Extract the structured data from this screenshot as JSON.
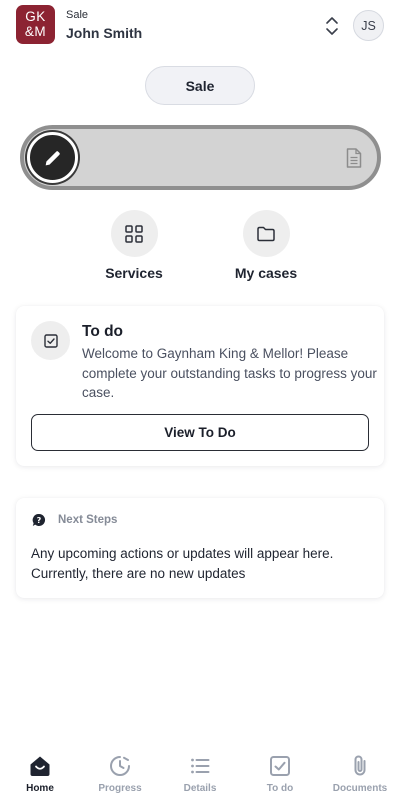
{
  "header": {
    "logo_top": "GK",
    "logo_bottom": "&M",
    "case_type": "Sale",
    "client_name": "John Smith",
    "avatar_initials": "JS"
  },
  "case_selector": {
    "label": "Sale"
  },
  "slider": {
    "knob_icon": "pencil-icon",
    "end_icon": "document-icon"
  },
  "quick_actions": [
    {
      "label": "Services",
      "icon": "grid-icon"
    },
    {
      "label": "My cases",
      "icon": "folder-icon"
    }
  ],
  "todo_card": {
    "icon": "checkbox-icon",
    "title": "To do",
    "text": "Welcome to Gaynham King & Mellor! Please complete your outstanding tasks to progress your case.",
    "button_label": "View To Do"
  },
  "next_steps": {
    "icon": "chat-bubble-icon",
    "title": "Next Steps",
    "text": "Any upcoming actions or updates will appear here. Currently, there are no new updates"
  },
  "bottom_nav": [
    {
      "label": "Home",
      "icon": "home-icon",
      "active": true
    },
    {
      "label": "Progress",
      "icon": "clock-icon",
      "active": false
    },
    {
      "label": "Details",
      "icon": "list-icon",
      "active": false
    },
    {
      "label": "To do",
      "icon": "checkbox-icon",
      "active": false
    },
    {
      "label": "Documents",
      "icon": "paperclip-icon",
      "active": false
    }
  ],
  "colors": {
    "brand": "#8c2332",
    "active_text": "#1b1f2a",
    "inactive_nav": "#9aa1ae",
    "slider_track": "#d3d3d3",
    "slider_border": "#8f8f8f"
  }
}
